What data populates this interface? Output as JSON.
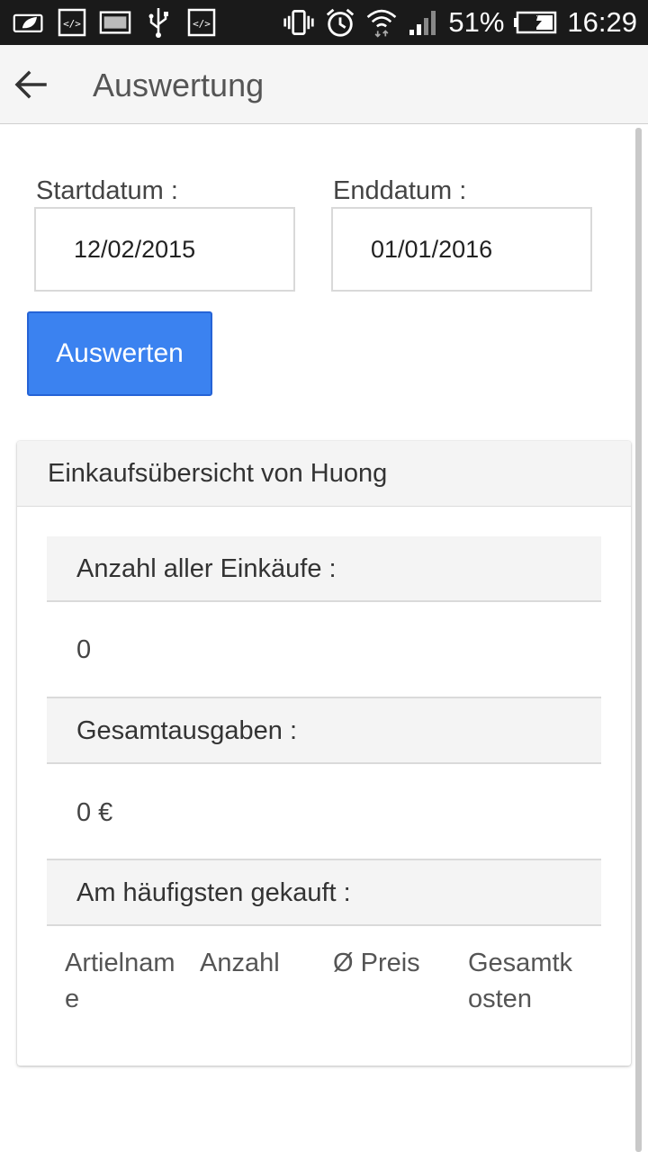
{
  "status_bar": {
    "battery": "51%",
    "time": "16:29",
    "icons": [
      "leaf-icon",
      "code-icon",
      "image-icon",
      "usb-icon",
      "code-icon",
      "vibrate-icon",
      "alarm-icon",
      "wifi-icon",
      "signal-icon",
      "battery-charging-icon"
    ]
  },
  "app_bar": {
    "title": "Auswertung",
    "back_icon": "arrow-left-icon"
  },
  "form": {
    "start_label": "Startdatum :",
    "start_value": "12/02/2015",
    "end_label": "Enddatum :",
    "end_value": "01/01/2016",
    "submit_label": "Auswerten"
  },
  "card": {
    "title": "Einkaufsübersicht von Huong",
    "count_label": "Anzahl aller Einkäufe :",
    "count_value": "0",
    "total_label": "Gesamtausgaben :",
    "total_value": "0 €",
    "top_label": "Am häufigsten gekauft :",
    "columns": [
      "Artielname",
      "Anzahl",
      "Ø Preis",
      "Gesamtkosten"
    ]
  },
  "colors": {
    "accent": "#3b82f0",
    "status_bar": "#1a1a1a",
    "app_bar": "#f5f5f5"
  }
}
